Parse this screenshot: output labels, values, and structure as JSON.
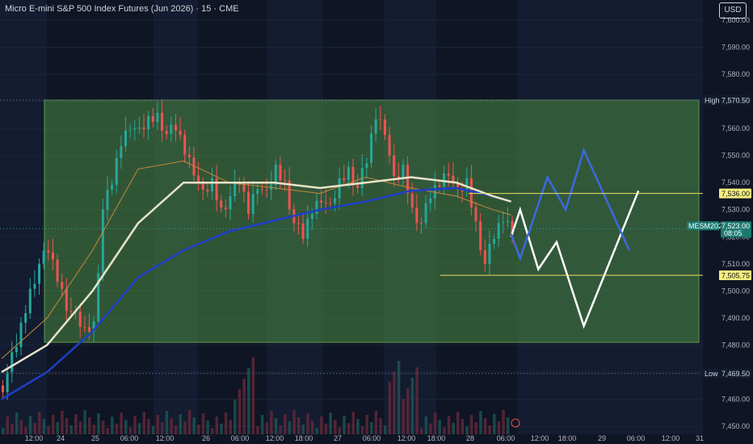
{
  "header": {
    "title": "Micro E-mini S&P 500 Index Futures (Jun 2026) · 15 · CME",
    "currency": "USD"
  },
  "chart_data": {
    "type": "candlestick",
    "y_ticks": [
      "7,600.00",
      "7,590.00",
      "7,580.00",
      "7,570.00",
      "7,560.00",
      "7,550.00",
      "7,540.00",
      "7,530.00",
      "7,520.00",
      "7,510.00",
      "7,500.00",
      "7,490.00",
      "7,480.00",
      "7,470.00",
      "7,460.00",
      "7,450.00"
    ],
    "ylim": [
      7450,
      7602
    ],
    "x_ticks": [
      "12:00",
      "24",
      "25",
      "06:00",
      "12:00",
      "26",
      "06:00",
      "12:00",
      "18:00",
      "27",
      "06:00",
      "12:00",
      "18:00",
      "28",
      "06:00",
      "12:00",
      "18:00",
      "29",
      "06:00",
      "12:00",
      "31"
    ],
    "high_label": "High",
    "high_value": "7,570.50",
    "low_label": "Low",
    "low_value": "7,469.50",
    "level_upper": "7,536.00",
    "level_lower": "7,505.75",
    "symbol": "MESM2026",
    "last_price": "7,523.00",
    "countdown": "08:05",
    "price_path": [
      [
        0,
        7465
      ],
      [
        3,
        7480
      ],
      [
        6,
        7500
      ],
      [
        8,
        7510
      ],
      [
        10,
        7515
      ],
      [
        12,
        7505
      ],
      [
        14,
        7495
      ],
      [
        16,
        7490
      ],
      [
        18,
        7485
      ],
      [
        20,
        7488
      ],
      [
        22,
        7530
      ],
      [
        24,
        7540
      ],
      [
        26,
        7555
      ],
      [
        28,
        7562
      ],
      [
        30,
        7558
      ],
      [
        32,
        7563
      ],
      [
        34,
        7565
      ],
      [
        36,
        7558
      ],
      [
        38,
        7560
      ],
      [
        40,
        7552
      ],
      [
        42,
        7545
      ],
      [
        44,
        7535
      ],
      [
        46,
        7540
      ],
      [
        48,
        7530
      ],
      [
        50,
        7535
      ],
      [
        52,
        7540
      ],
      [
        54,
        7530
      ],
      [
        56,
        7540
      ],
      [
        58,
        7535
      ],
      [
        60,
        7545
      ],
      [
        62,
        7540
      ],
      [
        64,
        7525
      ],
      [
        66,
        7520
      ],
      [
        68,
        7530
      ],
      [
        70,
        7535
      ],
      [
        72,
        7530
      ],
      [
        74,
        7540
      ],
      [
        76,
        7545
      ],
      [
        78,
        7538
      ],
      [
        80,
        7548
      ],
      [
        82,
        7565
      ],
      [
        84,
        7560
      ],
      [
        86,
        7540
      ],
      [
        88,
        7545
      ],
      [
        90,
        7530
      ],
      [
        92,
        7525
      ],
      [
        94,
        7535
      ],
      [
        96,
        7540
      ],
      [
        98,
        7545
      ],
      [
        100,
        7535
      ],
      [
        102,
        7540
      ],
      [
        104,
        7525
      ],
      [
        106,
        7510
      ],
      [
        108,
        7520
      ],
      [
        110,
        7527
      ],
      [
        112,
        7523
      ]
    ],
    "sma_white": [
      [
        0,
        7470
      ],
      [
        10,
        7480
      ],
      [
        20,
        7500
      ],
      [
        30,
        7525
      ],
      [
        40,
        7540
      ],
      [
        50,
        7540
      ],
      [
        60,
        7540
      ],
      [
        70,
        7538
      ],
      [
        80,
        7540
      ],
      [
        90,
        7542
      ],
      [
        100,
        7540
      ],
      [
        108,
        7535
      ],
      [
        112,
        7533
      ]
    ],
    "sma_blue": [
      [
        0,
        7460
      ],
      [
        10,
        7470
      ],
      [
        20,
        7485
      ],
      [
        30,
        7505
      ],
      [
        40,
        7515
      ],
      [
        50,
        7522
      ],
      [
        60,
        7526
      ],
      [
        70,
        7530
      ],
      [
        80,
        7533
      ],
      [
        90,
        7537
      ],
      [
        100,
        7538
      ],
      [
        108,
        7535
      ],
      [
        112,
        7533
      ]
    ],
    "sma_orange": [
      [
        0,
        7475
      ],
      [
        10,
        7490
      ],
      [
        20,
        7515
      ],
      [
        30,
        7545
      ],
      [
        40,
        7548
      ],
      [
        50,
        7540
      ],
      [
        60,
        7538
      ],
      [
        70,
        7536
      ],
      [
        80,
        7542
      ],
      [
        90,
        7538
      ],
      [
        100,
        7535
      ],
      [
        108,
        7530
      ],
      [
        112,
        7528
      ]
    ],
    "projection_white": [
      [
        112,
        7520
      ],
      [
        114,
        7530
      ],
      [
        118,
        7508
      ],
      [
        122,
        7518
      ],
      [
        128,
        7487
      ],
      [
        140,
        7537
      ]
    ],
    "projection_blue": [
      [
        112,
        7521
      ],
      [
        114,
        7512
      ],
      [
        120,
        7542
      ],
      [
        124,
        7530
      ],
      [
        128,
        7552
      ],
      [
        138,
        7515
      ]
    ]
  }
}
